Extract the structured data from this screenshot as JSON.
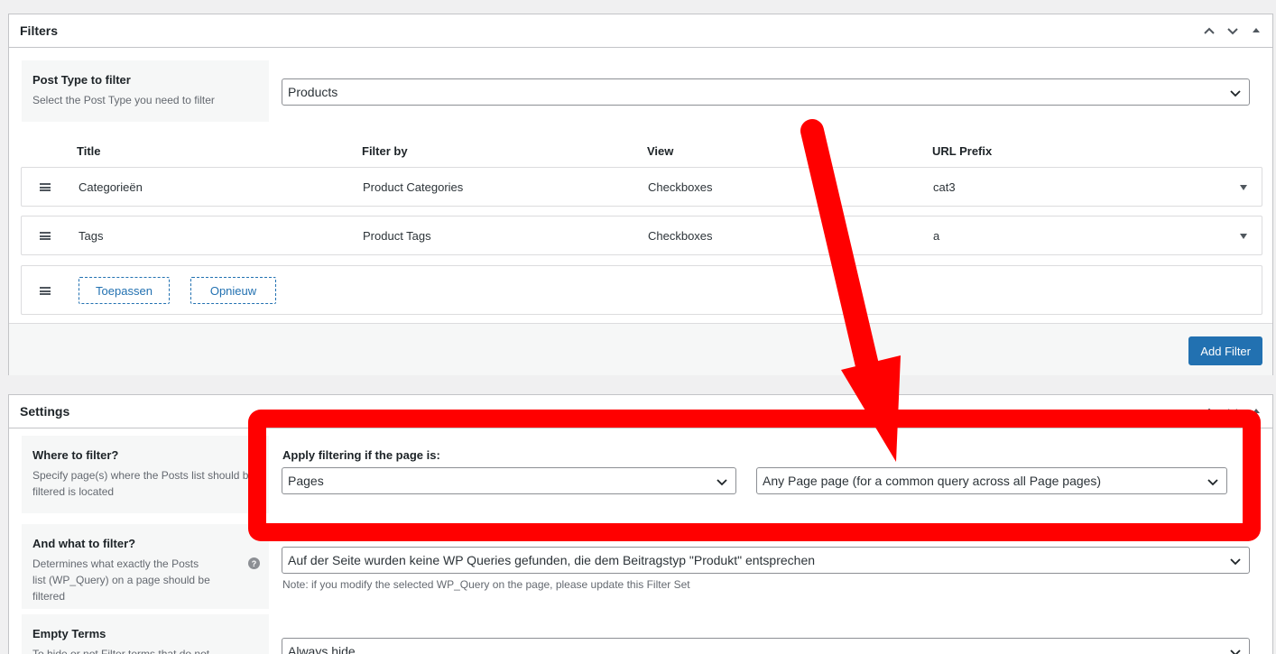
{
  "filters_panel": {
    "title": "Filters",
    "post_type": {
      "label": "Post Type to filter",
      "description": "Select the Post Type you need to filter",
      "value": "Products"
    },
    "columns": [
      "Title",
      "Filter by",
      "View",
      "URL Prefix"
    ],
    "rows": [
      {
        "title": "Categorieën",
        "filter_by": "Product Categories",
        "view": "Checkboxes",
        "url_prefix": "cat3"
      },
      {
        "title": "Tags",
        "filter_by": "Product Tags",
        "view": "Checkboxes",
        "url_prefix": "a"
      }
    ],
    "buttons": {
      "apply": "Toepassen",
      "reset": "Opnieuw"
    },
    "add_filter_label": "Add Filter"
  },
  "settings_panel": {
    "title": "Settings",
    "where": {
      "label": "Where to filter?",
      "description": "Specify page(s) where the Posts list should be filtered is located",
      "apply_label": "Apply filtering if the page is:",
      "page_type": "Pages",
      "page_scope": "Any Page page (for a common query across all Page pages)"
    },
    "what": {
      "label": "And what to filter?",
      "description": "Determines what exactly the Posts list (WP_Query) on a page should be filtered",
      "help": "?",
      "value": "Auf der Seite wurden keine WP Queries gefunden, die dem Beitragstyp \"Produkt\" entsprechen",
      "note": "Note: if you modify the selected WP_Query on the page, please update this Filter Set"
    },
    "empty_terms": {
      "label": "Empty Terms",
      "description": "To hide or not Filter terms that do not",
      "value": "Always hide"
    }
  },
  "annotation": {
    "color": "#ff0000"
  },
  "colors": {
    "accent": "#2271b1",
    "border": "#c3c4c7",
    "label_bg": "#f6f7f7"
  }
}
